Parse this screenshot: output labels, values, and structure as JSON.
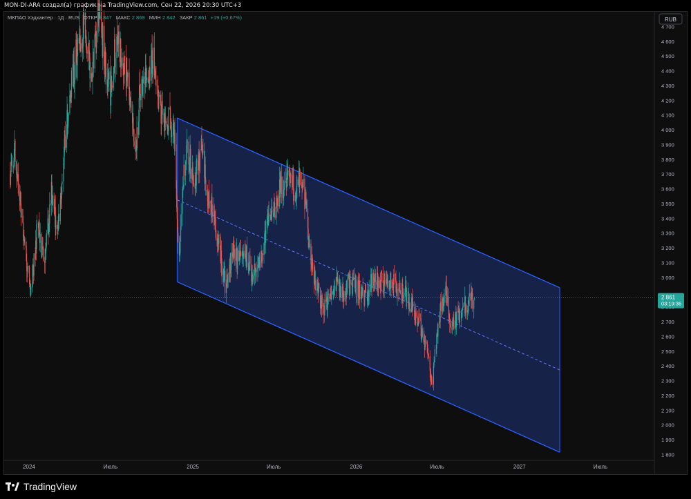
{
  "header_text": "MON-DI-ARA создал(а) график на TradingView.com, Сен 22, 2026 20:30 UTC+3",
  "brand": "TradingView",
  "legend": {
    "symbol": "МКПАО Хэдхантер · 1Д · RUS",
    "open_label": "ОТКР",
    "open_value": "2 847",
    "high_label": "МАКС",
    "high_value": "2 869",
    "low_label": "МИН",
    "low_value": "2 842",
    "close_label": "ЗАКР",
    "close_value": "2 861",
    "change": "+19 (+0,67%)"
  },
  "currency_button": "RUB",
  "price_badge": {
    "value": "2 861",
    "countdown": "03:19:36"
  },
  "colors": {
    "up": "#26a69a",
    "down": "#ef5350",
    "channel_line": "#2962ff",
    "channel_fill": "#1b2a5e",
    "badge": "#26a69a",
    "background": "#0e0e0e"
  },
  "chart_data": {
    "type": "candlestick",
    "y_ticks": [
      "4 700",
      "4 600",
      "4 500",
      "4 400",
      "4 300",
      "4 200",
      "4 100",
      "4 000",
      "3 900",
      "3 800",
      "3 700",
      "3 600",
      "3 500",
      "3 400",
      "3 300",
      "3 200",
      "3 100",
      "3 000",
      "2 900",
      "2 800",
      "2 700",
      "2 600",
      "2 500",
      "2 400",
      "2 300",
      "2 200",
      "2 100",
      "2 000",
      "1 900",
      "1 800"
    ],
    "ylim": [
      1760,
      4800
    ],
    "x_axis": [
      "2024-01-01",
      "2027-10-31"
    ],
    "x_ticks": [
      {
        "label": "2024",
        "date": "2024-01-01"
      },
      {
        "label": "Июль",
        "date": "2024-07-01"
      },
      {
        "label": "2025",
        "date": "2025-01-01"
      },
      {
        "label": "Июль",
        "date": "2025-07-01"
      },
      {
        "label": "2026",
        "date": "2026-01-01"
      },
      {
        "label": "Июль",
        "date": "2026-07-01"
      },
      {
        "label": "2027",
        "date": "2027-01-01"
      },
      {
        "label": "Июль",
        "date": "2027-07-01"
      }
    ],
    "price_path": [
      [
        "2023-11-20",
        3700
      ],
      [
        "2023-12-01",
        3880
      ],
      [
        "2023-12-15",
        3400
      ],
      [
        "2024-01-05",
        2900
      ],
      [
        "2024-01-20",
        3350
      ],
      [
        "2024-02-05",
        3100
      ],
      [
        "2024-02-20",
        3600
      ],
      [
        "2024-03-05",
        3300
      ],
      [
        "2024-03-20",
        3900
      ],
      [
        "2024-04-05",
        4300
      ],
      [
        "2024-04-20",
        4600
      ],
      [
        "2024-05-05",
        4700
      ],
      [
        "2024-05-20",
        4350
      ],
      [
        "2024-06-05",
        4800
      ],
      [
        "2024-06-20",
        4450
      ],
      [
        "2024-07-01",
        4250
      ],
      [
        "2024-07-15",
        4650
      ],
      [
        "2024-08-01",
        4400
      ],
      [
        "2024-08-15",
        4200
      ],
      [
        "2024-08-25",
        3800
      ],
      [
        "2024-09-05",
        4250
      ],
      [
        "2024-09-20",
        4350
      ],
      [
        "2024-10-05",
        4500
      ],
      [
        "2024-10-20",
        4150
      ],
      [
        "2024-11-01",
        4100
      ],
      [
        "2024-11-20",
        4000
      ],
      [
        "2024-12-01",
        3100
      ],
      [
        "2024-12-10",
        3650
      ],
      [
        "2024-12-20",
        3850
      ],
      [
        "2025-01-05",
        3650
      ],
      [
        "2025-01-20",
        3850
      ],
      [
        "2025-02-01",
        3600
      ],
      [
        "2025-02-15",
        3450
      ],
      [
        "2025-03-01",
        3200
      ],
      [
        "2025-03-15",
        2950
      ],
      [
        "2025-04-01",
        3200
      ],
      [
        "2025-04-15",
        3100
      ],
      [
        "2025-05-01",
        3150
      ],
      [
        "2025-05-15",
        3000
      ],
      [
        "2025-06-01",
        3100
      ],
      [
        "2025-06-15",
        3350
      ],
      [
        "2025-07-01",
        3450
      ],
      [
        "2025-07-15",
        3600
      ],
      [
        "2025-08-01",
        3650
      ],
      [
        "2025-08-15",
        3600
      ],
      [
        "2025-09-01",
        3650
      ],
      [
        "2025-09-10",
        3500
      ],
      [
        "2025-09-20",
        3150
      ],
      [
        "2025-10-05",
        2950
      ],
      [
        "2025-10-20",
        2780
      ],
      [
        "2025-11-01",
        2850
      ],
      [
        "2025-11-15",
        2950
      ],
      [
        "2025-12-01",
        2900
      ],
      [
        "2025-12-15",
        2950
      ],
      [
        "2026-01-05",
        2920
      ],
      [
        "2026-01-20",
        2850
      ],
      [
        "2026-02-05",
        2980
      ],
      [
        "2026-02-20",
        3000
      ],
      [
        "2026-03-05",
        2950
      ],
      [
        "2026-03-20",
        2980
      ],
      [
        "2026-04-05",
        2900
      ],
      [
        "2026-04-20",
        2880
      ],
      [
        "2026-05-05",
        2800
      ],
      [
        "2026-05-20",
        2700
      ],
      [
        "2026-06-01",
        2600
      ],
      [
        "2026-06-10",
        2480
      ],
      [
        "2026-06-20",
        2250
      ],
      [
        "2026-07-01",
        2650
      ],
      [
        "2026-07-10",
        2800
      ],
      [
        "2026-07-20",
        2900
      ],
      [
        "2026-08-01",
        2650
      ],
      [
        "2026-08-15",
        2720
      ],
      [
        "2026-09-01",
        2820
      ],
      [
        "2026-09-22",
        2861
      ]
    ],
    "channel": {
      "upper": [
        [
          "2024-11-27",
          4080
        ],
        [
          "2027-04-01",
          2930
        ]
      ],
      "lower": [
        [
          "2024-11-27",
          2970
        ],
        [
          "2027-04-01",
          1815
        ]
      ],
      "mid_dashed": true
    },
    "last_price": 2861
  }
}
